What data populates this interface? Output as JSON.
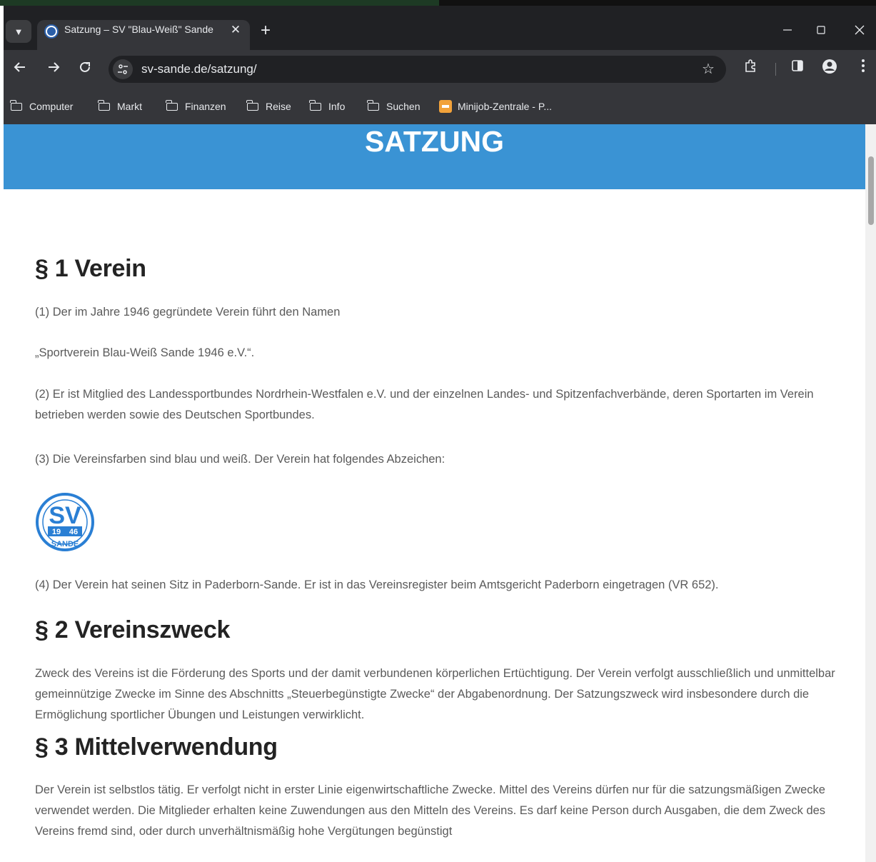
{
  "browser": {
    "tab_title": "Satzung – SV \"Blau-Weiß\" Sande",
    "tab_close": "✕",
    "new_tab": "+",
    "url": "sv-sande.de/satzung/",
    "bookmarks": [
      "Computer",
      "Markt",
      "Finanzen",
      "Reise",
      "Info",
      "Suchen",
      "Minijob-Zentrale - P..."
    ]
  },
  "page": {
    "hero_title": "SATZUNG",
    "sections": [
      {
        "heading": "§ 1 Verein",
        "p1": "(1) Der im Jahre 1946 gegründete Verein führt den Namen",
        "p2": "„Sportverein Blau-Weiß Sande 1946 e.V.“.",
        "p3": "(2) Er ist Mitglied des Landessportbundes Nordrhein-Westfalen e.V. und der einzelnen Landes- und Spitzenfachverbände, deren Sportarten im Verein betrieben werden sowie des Deutschen Sportbundes.",
        "p4": "(3) Die Vereinsfarben sind blau und weiß. Der Verein hat folgendes Abzeichen:",
        "p5": "(4) Der Verein hat seinen Sitz in Paderborn-Sande. Er ist in das Vereinsregister beim Amtsgericht Paderborn eingetragen (VR 652)."
      },
      {
        "heading": "§ 2 Vereinszweck",
        "p1": "Zweck des Vereins ist die Förderung des Sports und der damit verbundenen körperlichen Ertüchtigung. Der Verein verfolgt ausschließlich und unmittelbar gemeinnützige Zwecke im Sinne des Abschnitts „Steuerbegünstigte Zwecke“ der Abgabenordnung. Der Satzungszweck wird insbesondere durch die Ermöglichung sportlicher Übungen und Leistungen verwirklicht."
      },
      {
        "heading": "§ 3 Mittelverwendung",
        "p1": "Der Verein ist selbstlos tätig. Er verfolgt nicht in erster Linie eigenwirtschaftliche Zwecke. Mittel des Vereins dürfen nur für die satzungsmäßigen Zwecke verwendet werden. Die Mitglieder erhalten keine Zuwendungen aus den Mitteln des Vereins. Es darf keine Person durch Ausgaben, die dem Zweck des Vereins fremd sind, oder durch unverhältnismäßig hohe Vergütungen begünstigt"
      }
    ],
    "logo": {
      "letters": "SV",
      "year_left": "19",
      "year_right": "46",
      "name": "SANDE",
      "color": "#2a7fd4"
    }
  },
  "colors": {
    "hero_bg": "#3a93d4",
    "heading": "#232323",
    "body_text": "#5a5a5a"
  }
}
